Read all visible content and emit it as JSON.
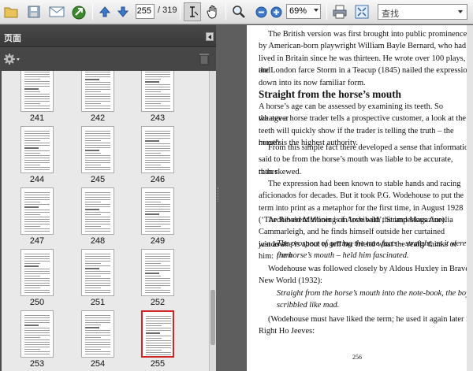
{
  "toolbar": {
    "current_page": "255",
    "total_pages": "/ 319",
    "zoom": "69%",
    "search_placeholder": "查找"
  },
  "sidebar": {
    "title": "页面",
    "thumbnail_labels": [
      "241",
      "242",
      "243",
      "244",
      "245",
      "246",
      "247",
      "248",
      "249",
      "250",
      "251",
      "252",
      "253",
      "254",
      "255"
    ],
    "selected_page": "255"
  },
  "document": {
    "paragraph_1_lines": [
      "The British version was first brought into public prominence",
      "by American-born playwright William Bayle Bernard, who had",
      "lived in Britain since he was thirteen. He wrote over 100 plays, and",
      "the London farce Storm in a Teacup (1845) nailed the expression",
      "down into its now familiar form."
    ],
    "heading": "Straight from the horse’s mouth",
    "paragraph_2_lines": [
      "A horse’s age can be assessed by examining its teeth. So whatever",
      "the age a horse trader tells a prospective customer, a look at the",
      "teeth will quickly show if the trader is telling the truth – the horse’s",
      "mouth is the highest authority."
    ],
    "paragraph_3_lines": [
      "From this simple fact there developed a sense that information",
      "said to be from the horse’s mouth was liable to be accurate, rather",
      "than skewed."
    ],
    "paragraph_4_lines": [
      "The expression had been known to stable hands and racing",
      "aficionados for decades. But it took P.G. Wodehouse to put the",
      "term into print as a metaphor for the first time, in August 1928",
      "(‘The Reverent Wooing of Archibald’, Strand Magazine)."
    ],
    "paragraph_5_lines": [
      "Archibald Mulliner is in love with the imperious Aurelia",
      "Cammarleigh, and he finds himself outside her curtained window",
      "just as she is about to tell her friend what the really thinks of him:"
    ],
    "quote_1_lines": [
      "The prospect of getting the true facts – straight, as it were, from",
      "the horse’s mouth – held him fascinated."
    ],
    "paragraph_6_lines": [
      "Wodehouse was followed closely by Aldous Huxley in Brave",
      "New World (1932):"
    ],
    "quote_2_lines": [
      "Straight from the horse’s mouth into the note-book, the boys",
      "scribbled like mad."
    ],
    "paragraph_7_lines": [
      "(Wodehouse must have liked the term; he used it again later in",
      "Right Ho Jeeves:"
    ],
    "page_number": "256"
  }
}
